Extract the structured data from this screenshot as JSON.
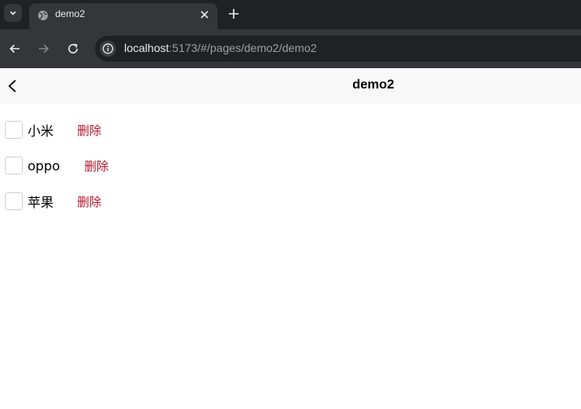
{
  "browser": {
    "tab": {
      "title": "demo2"
    },
    "omnibox": {
      "host": "localhost",
      "path": ":5173/#/pages/demo2/demo2"
    }
  },
  "page": {
    "title": "demo2"
  },
  "items": [
    {
      "name": "小米",
      "delete_label": "删除",
      "checked": false
    },
    {
      "name": "oppo",
      "delete_label": "删除",
      "checked": false
    },
    {
      "name": "苹果",
      "delete_label": "删除",
      "checked": false
    }
  ],
  "colors": {
    "tabstrip": "#202124",
    "toolbar": "#35363a",
    "navbar": "#f8f8f8",
    "delete_text": "#b0172d"
  }
}
